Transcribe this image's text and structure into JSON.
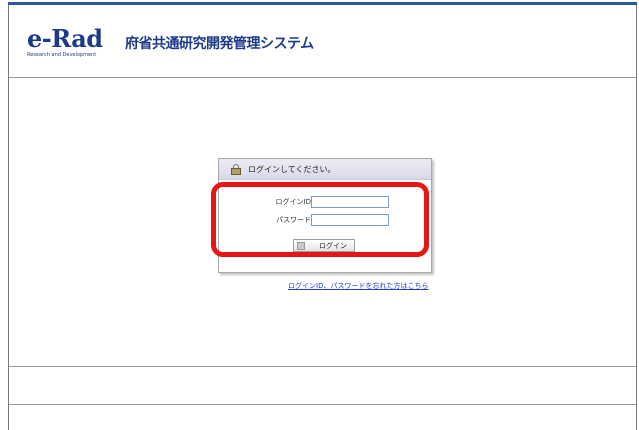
{
  "header": {
    "logo_text": "e-Rad",
    "logo_subtext": "Research and Development",
    "system_title": "府省共通研究開発管理システム"
  },
  "login": {
    "heading": "ログインしてください。",
    "id_label": "ログインID",
    "id_value": "",
    "password_label": "パスワード",
    "password_value": "",
    "button_label": "ログイン"
  },
  "forgot_link": "ログインID、パスワードを忘れた方はこちら",
  "colors": {
    "brand": "#1c3a8a",
    "highlight": "#e41616",
    "link": "#1f3fbf"
  },
  "icons": {
    "heading_icon": "lock-icon",
    "button_icon": "login-icon"
  }
}
